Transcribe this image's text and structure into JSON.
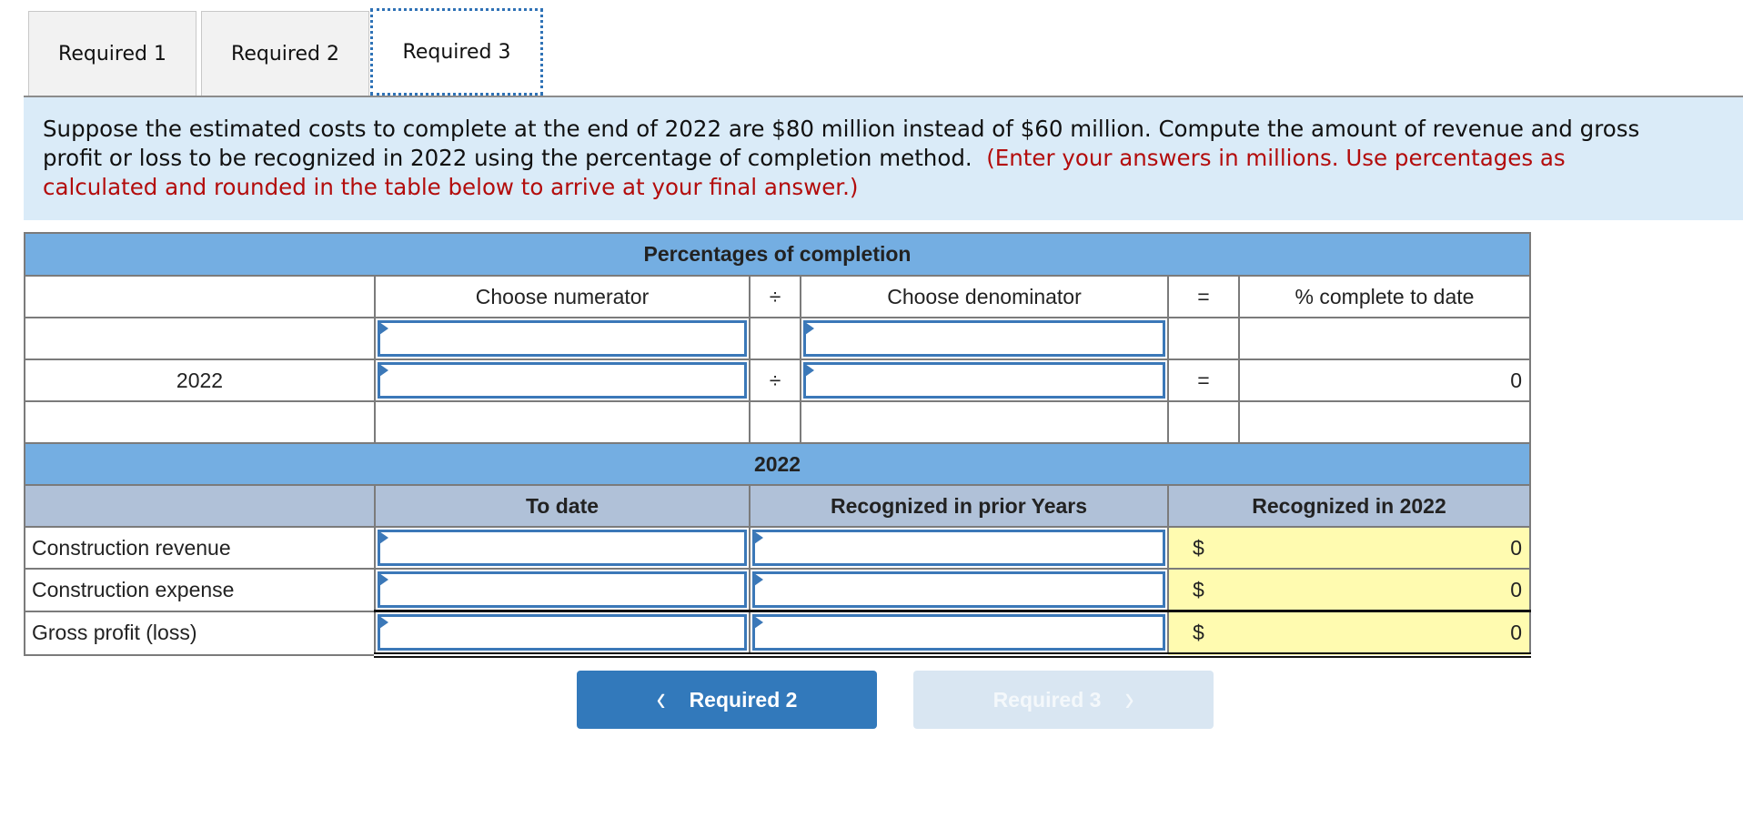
{
  "tabs": [
    {
      "label": "Required 1",
      "active": false
    },
    {
      "label": "Required 2",
      "active": false
    },
    {
      "label": "Required 3",
      "active": true
    }
  ],
  "instructions": {
    "line1": "Suppose the estimated costs to complete at the end of 2022 are $80 million instead of $60 million. Compute the amount of revenue and gross",
    "line2_black": "profit or loss to be recognized in 2022 using the percentage of completion method.",
    "line2_red": "(Enter your answers in millions. Use percentages as",
    "line3_red": "calculated and rounded in the table below to arrive at your final answer.)"
  },
  "percentages_table": {
    "title": "Percentages of completion",
    "headers": {
      "numerator": "Choose numerator",
      "divide": "÷",
      "denominator": "Choose denominator",
      "equals": "=",
      "result": "% complete to date"
    },
    "rows": [
      {
        "label": "",
        "numerator": "",
        "divide": "",
        "denominator": "",
        "equals": "",
        "result": ""
      },
      {
        "label": "2022",
        "numerator": "",
        "divide": "÷",
        "denominator": "",
        "equals": "=",
        "result": "0"
      },
      {
        "label": "",
        "numerator": "",
        "divide": "",
        "denominator": "",
        "equals": "",
        "result": ""
      }
    ]
  },
  "recognition_table": {
    "title": "2022",
    "headers": {
      "to_date": "To date",
      "prior_years": "Recognized in prior Years",
      "current": "Recognized in 2022"
    },
    "currency": "$",
    "rows": [
      {
        "label": "Construction revenue",
        "to_date": "",
        "prior_years": "",
        "current": "0"
      },
      {
        "label": "Construction expense",
        "to_date": "",
        "prior_years": "",
        "current": "0"
      },
      {
        "label": "Gross profit (loss)",
        "to_date": "",
        "prior_years": "",
        "current": "0"
      }
    ]
  },
  "nav": {
    "prev_label": "Required 2",
    "next_label": "Required 3",
    "prev_icon": "chevron-left-icon",
    "next_icon": "chevron-right-icon"
  },
  "colors": {
    "band": "#74aee2",
    "subheader": "#b0c1d8",
    "info_bg": "#daebf8",
    "instruction_red": "#b30c0c",
    "computed_cell": "#fffbb0",
    "primary_button": "#3279bb",
    "disabled_button": "#d9e6f2"
  }
}
